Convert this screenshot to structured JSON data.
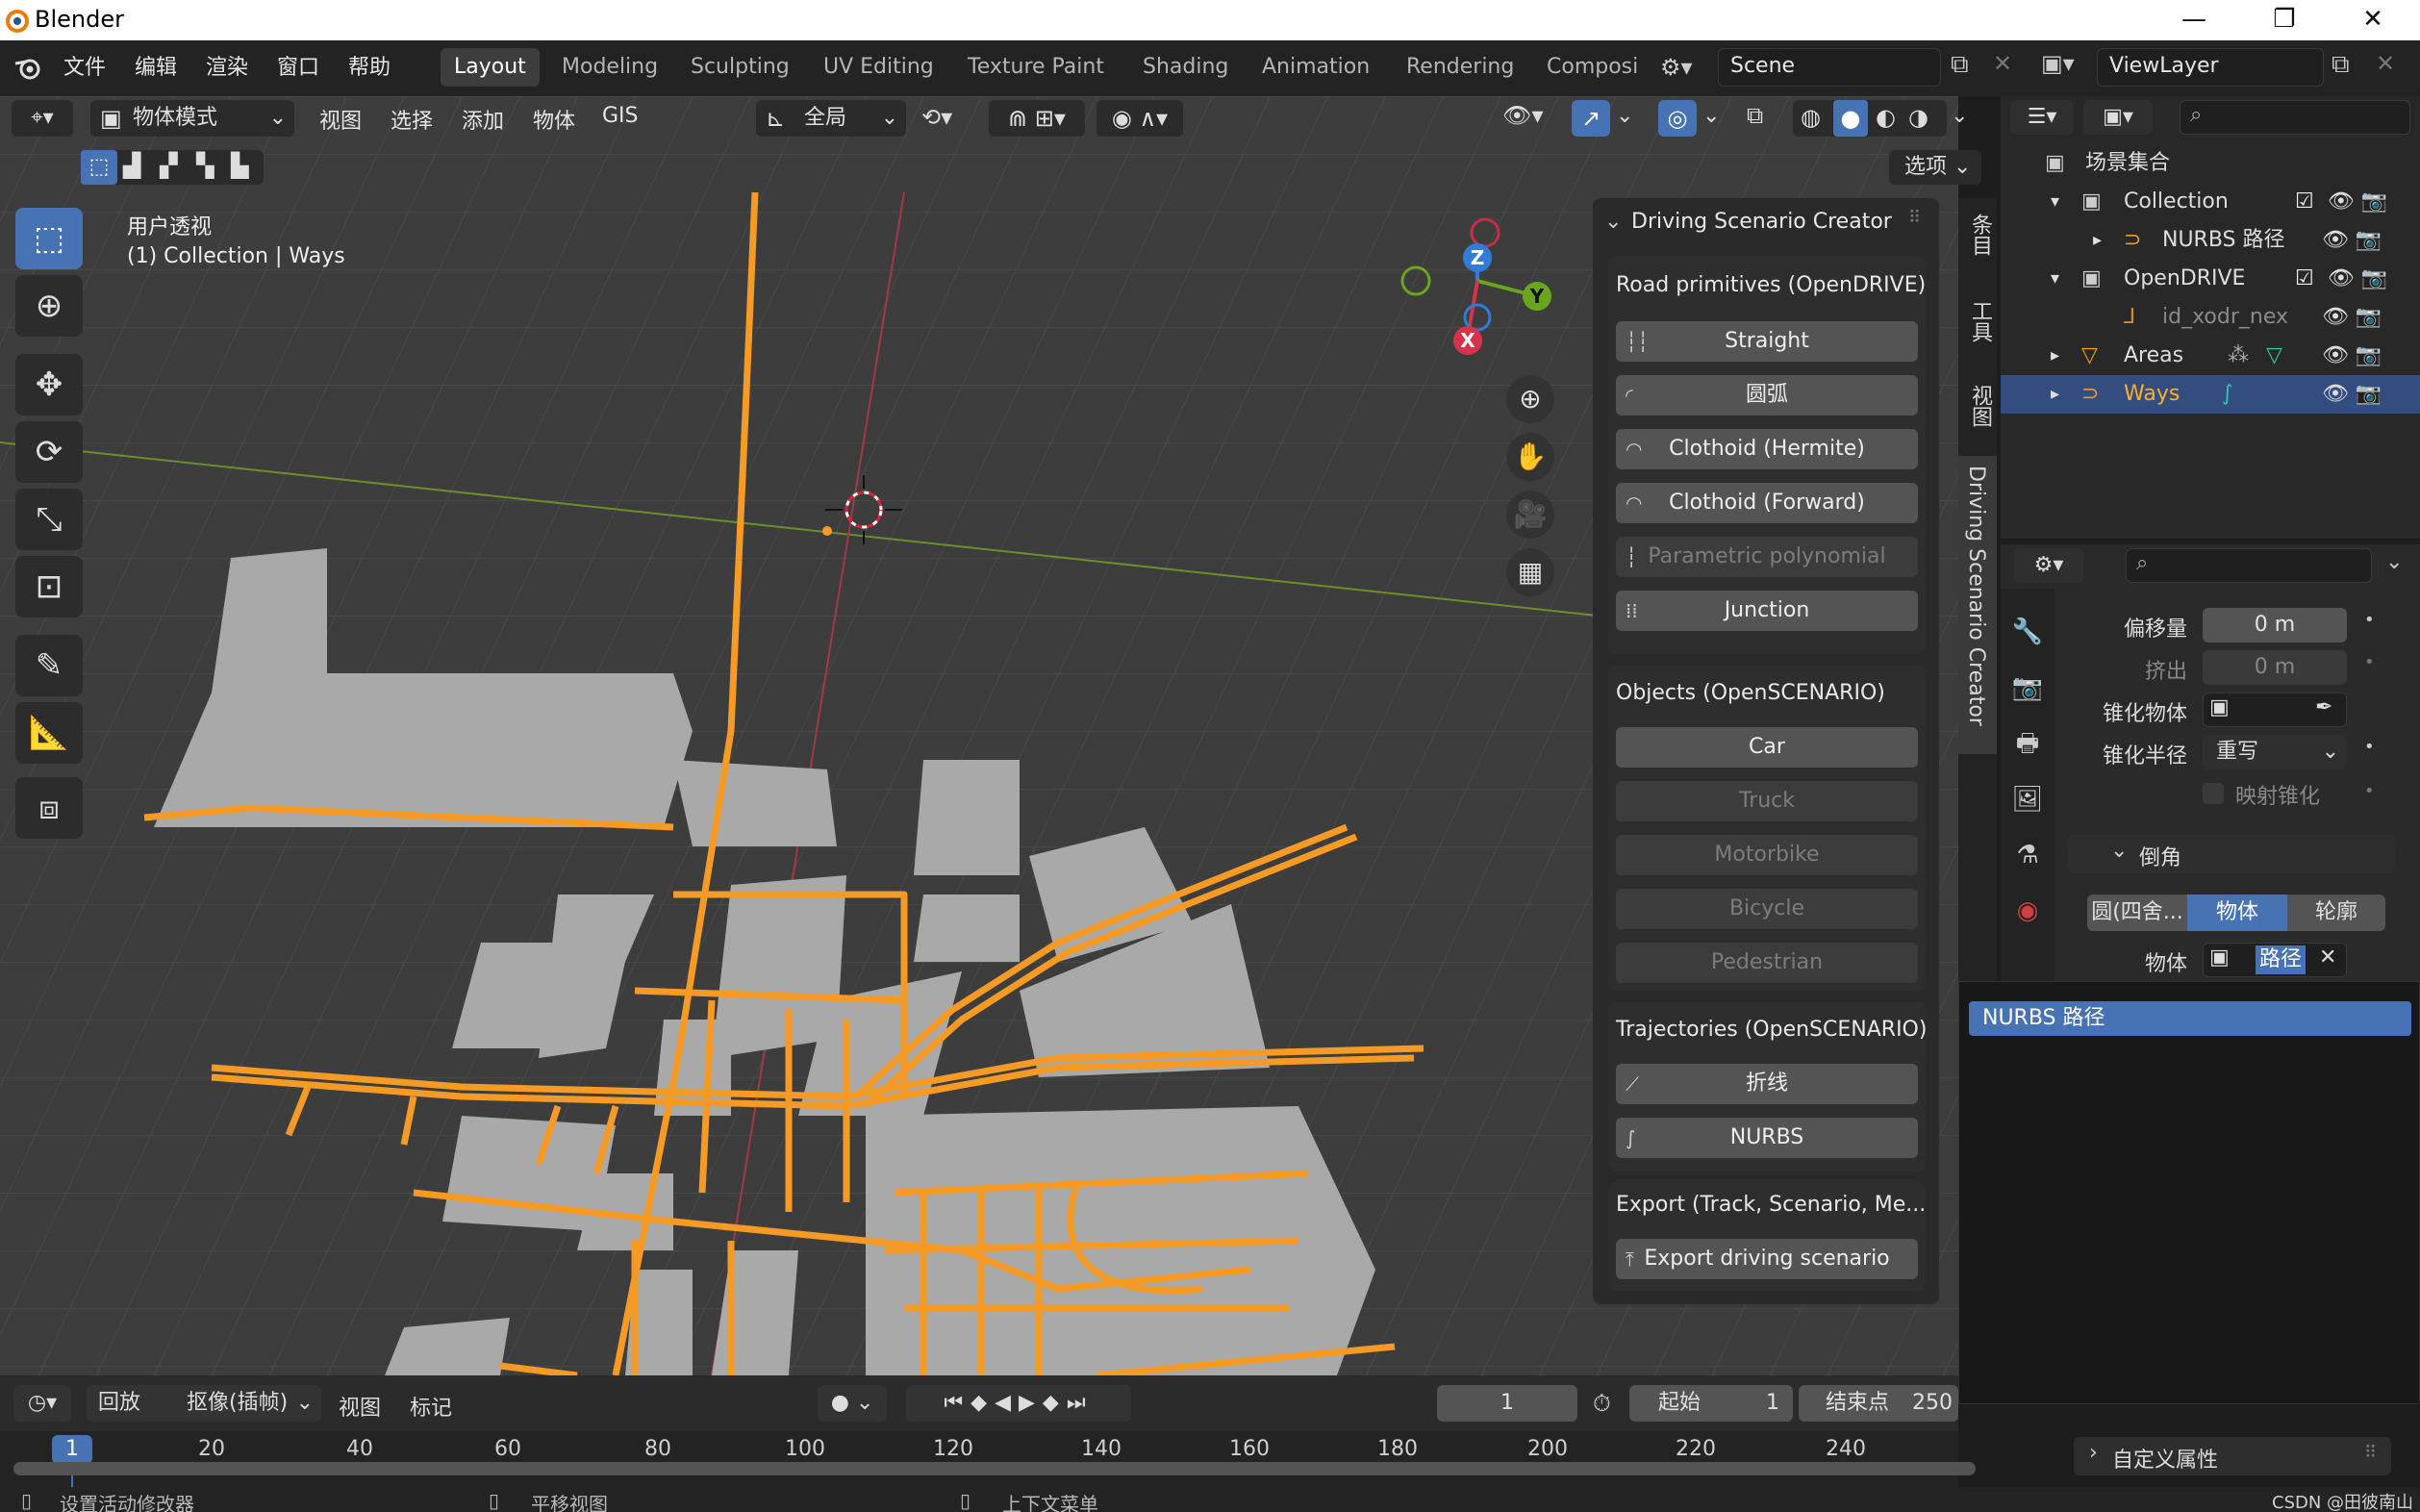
{
  "window": {
    "title": "Blender",
    "minimize": "—",
    "maximize": "❐",
    "close": "✕"
  },
  "topbar": {
    "menus": [
      "文件",
      "编辑",
      "渲染",
      "窗口",
      "帮助"
    ],
    "workspaces": [
      "Layout",
      "Modeling",
      "Sculpting",
      "UV Editing",
      "Texture Paint",
      "Shading",
      "Animation",
      "Rendering",
      "Composi"
    ],
    "active_workspace": "Layout",
    "scene_name": "Scene",
    "view_layer": "ViewLayer"
  },
  "viewport_header": {
    "mode": "物体模式",
    "menus": [
      "视图",
      "选择",
      "添加",
      "物体",
      "GIS"
    ],
    "transform_orientation": "全局",
    "options_button": "选项"
  },
  "viewport": {
    "view_name": "用户透视",
    "view_info": "(1) Collection | Ways",
    "gizmo": {
      "z": "Z",
      "y": "Y",
      "x": "X"
    }
  },
  "npanel": {
    "title": "Driving Scenario Creator",
    "tabs": [
      "条目",
      "工具",
      "视图",
      "Driving Scenario Creator"
    ],
    "road_section": {
      "title": "Road primitives (OpenDRIVE)",
      "buttons": [
        {
          "label": "Straight",
          "enabled": true
        },
        {
          "label": "圆弧",
          "enabled": true
        },
        {
          "label": "Clothoid (Hermite)",
          "enabled": true
        },
        {
          "label": "Clothoid (Forward)",
          "enabled": true
        },
        {
          "label": "Parametric polynomial",
          "enabled": false
        },
        {
          "label": "Junction",
          "enabled": true
        }
      ]
    },
    "objects_section": {
      "title": "Objects (OpenSCENARIO)",
      "buttons": [
        {
          "label": "Car",
          "enabled": true
        },
        {
          "label": "Truck",
          "enabled": false
        },
        {
          "label": "Motorbike",
          "enabled": false
        },
        {
          "label": "Bicycle",
          "enabled": false
        },
        {
          "label": "Pedestrian",
          "enabled": false
        }
      ]
    },
    "traj_section": {
      "title": "Trajectories (OpenSCENARIO)",
      "buttons": [
        {
          "label": "折线",
          "enabled": true
        },
        {
          "label": "NURBS",
          "enabled": true
        }
      ]
    },
    "export_section": {
      "title": "Export (Track, Scenario, Me...",
      "button": "Export driving scenario"
    }
  },
  "outliner": {
    "root": "场景集合",
    "rows": [
      {
        "label": "Collection",
        "indent": 0
      },
      {
        "label": "NURBS 路径",
        "indent": 1
      },
      {
        "label": "OpenDRIVE",
        "indent": 0
      },
      {
        "label": "id_xodr_nex",
        "indent": 1
      },
      {
        "label": "Areas",
        "indent": 0
      },
      {
        "label": "Ways",
        "indent": 0
      }
    ]
  },
  "properties": {
    "offset_label": "偏移量",
    "offset_value": "0 m",
    "extrude_label": "挤出",
    "extrude_value": "0 m",
    "taper_obj_label": "锥化物体",
    "taper_radius_label": "锥化半径",
    "taper_radius_value": "重写",
    "map_taper_label": "映射锥化",
    "bevel_label": "倒角",
    "bevel_modes": [
      "圆(四舍...",
      "物体",
      "轮廓"
    ],
    "bevel_object_label": "物体",
    "bevel_object_value": "路径",
    "custom_props": "自定义属性"
  },
  "dropdown": {
    "item": "NURBS 路径"
  },
  "timeline": {
    "playback": "回放",
    "keying": "抠像(插帧)",
    "view": "视图",
    "marker": "标记",
    "current_frame": "1",
    "start_label": "起始",
    "start_value": "1",
    "end_label": "结束点",
    "end_value": "250",
    "ticks": [
      "20",
      "40",
      "60",
      "80",
      "100",
      "120",
      "140",
      "160",
      "180",
      "200",
      "220",
      "240"
    ],
    "frame_marker": "1"
  },
  "status": {
    "left": "设置活动修改器",
    "middle": "平移视图",
    "right": "上下文菜单",
    "watermark": "CSDN @田彼南山"
  }
}
